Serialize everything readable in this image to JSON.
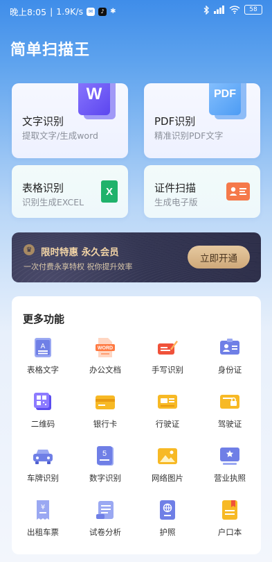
{
  "status_bar": {
    "time": "晚上8:05",
    "speed": "1.9K/s",
    "battery": "58"
  },
  "app": {
    "title": "简单扫描王"
  },
  "cards": [
    {
      "title": "文字识别",
      "subtitle": "提取文字/生成word",
      "icon": "word-doc-icon",
      "icon_text": "W"
    },
    {
      "title": "PDF识别",
      "subtitle": "精准识别PDF文字",
      "icon": "pdf-doc-icon",
      "icon_text": "PDF"
    },
    {
      "title": "表格识别",
      "subtitle": "识别生成EXCEL",
      "icon": "excel-icon",
      "icon_text": "X"
    },
    {
      "title": "证件扫描",
      "subtitle": "生成电子版",
      "icon": "id-card-icon"
    }
  ],
  "promo": {
    "title": "限时特惠 永久会员",
    "subtitle": "一次付费永享特权 祝你提升效率",
    "button": "立即开通"
  },
  "more": {
    "title": "更多功能",
    "items": [
      {
        "label": "表格文字",
        "icon": "table-text-icon"
      },
      {
        "label": "办公文档",
        "icon": "office-doc-icon"
      },
      {
        "label": "手写识别",
        "icon": "handwriting-icon"
      },
      {
        "label": "身份证",
        "icon": "id-card-icon"
      },
      {
        "label": "二维码",
        "icon": "qr-code-icon"
      },
      {
        "label": "银行卡",
        "icon": "bank-card-icon"
      },
      {
        "label": "行驶证",
        "icon": "driving-license-icon"
      },
      {
        "label": "驾驶证",
        "icon": "driver-license-icon"
      },
      {
        "label": "车牌识别",
        "icon": "car-plate-icon"
      },
      {
        "label": "数字识别",
        "icon": "number-icon"
      },
      {
        "label": "网络图片",
        "icon": "web-image-icon"
      },
      {
        "label": "营业执照",
        "icon": "business-license-icon"
      },
      {
        "label": "出租车票",
        "icon": "taxi-ticket-icon"
      },
      {
        "label": "试卷分析",
        "icon": "exam-paper-icon"
      },
      {
        "label": "护照",
        "icon": "passport-icon"
      },
      {
        "label": "户口本",
        "icon": "household-register-icon"
      }
    ]
  }
}
